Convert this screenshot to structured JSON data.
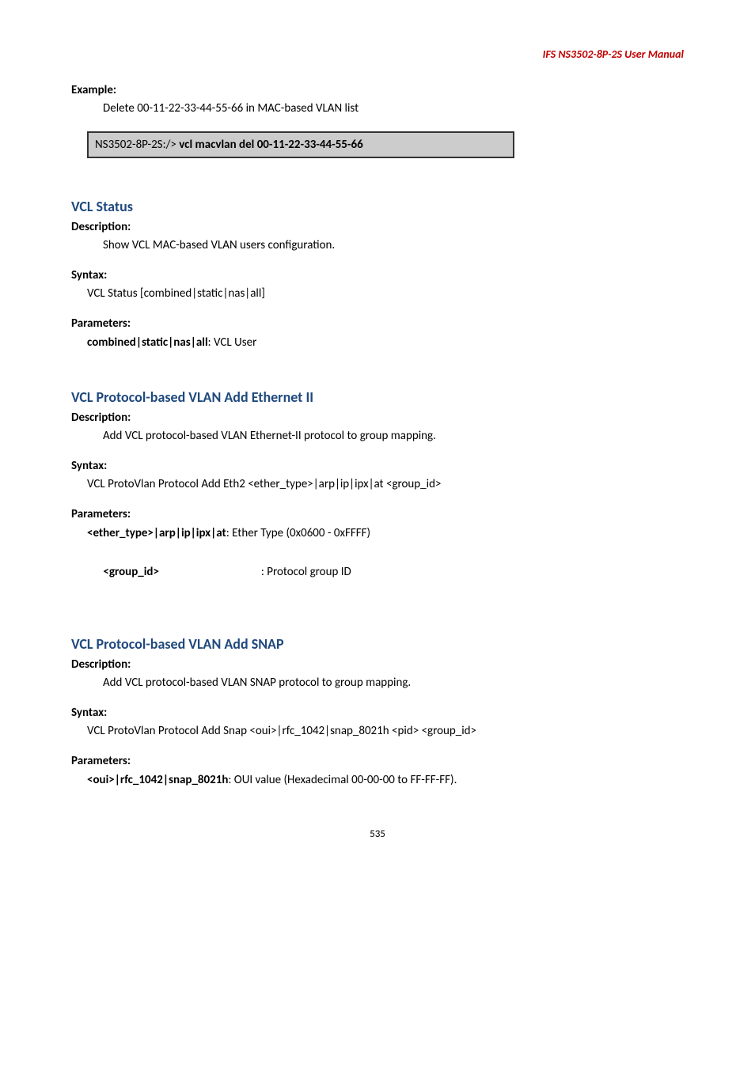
{
  "header": {
    "product": "IFS  NS3502-8P-2S  User  Manual"
  },
  "example": {
    "label": "Example:",
    "text": "Delete 00-11-22-33-44-55-66 in MAC-based VLAN list",
    "codePrefix": "NS3502-8P-2S:/> ",
    "codeCmd": "vcl macvlan del 00-11-22-33-44-55-66"
  },
  "sections": [
    {
      "title": "VCL Status",
      "description": {
        "label": "Description:",
        "text": "Show VCL MAC-based VLAN users configuration."
      },
      "syntax": {
        "label": "Syntax:",
        "text": "VCL Status [combined|static|nas|all]"
      },
      "parameters": {
        "label": "Parameters:",
        "items": [
          {
            "name": "combined|static|nas|all",
            "desc": ": VCL User"
          }
        ]
      }
    },
    {
      "title": "VCL Protocol-based VLAN Add Ethernet II",
      "description": {
        "label": "Description:",
        "text": "Add VCL protocol-based VLAN Ethernet-II protocol to group mapping."
      },
      "syntax": {
        "label": "Syntax:",
        "text": "VCL ProtoVlan Protocol Add Eth2 <ether_type>|arp|ip|ipx|at <group_id>"
      },
      "parameters": {
        "label": "Parameters:",
        "items": [
          {
            "name": "<ether_type>|arp|ip|ipx|at",
            "desc": ": Ether Type (0x0600 - 0xFFFF)"
          },
          {
            "name": "<group_id>",
            "desc": ": Protocol group ID",
            "pad": "                                      "
          }
        ]
      }
    },
    {
      "title": "VCL Protocol-based VLAN Add SNAP",
      "description": {
        "label": "Description:",
        "text": "Add VCL protocol-based VLAN SNAP protocol to group mapping."
      },
      "syntax": {
        "label": "Syntax:",
        "text": "VCL ProtoVlan Protocol Add Snap <oui>|rfc_1042|snap_8021h <pid> <group_id>"
      },
      "parameters": {
        "label": "Parameters:",
        "items": [
          {
            "name": "<oui>|rfc_1042|snap_8021h",
            "desc": ": OUI value (Hexadecimal 00-00-00 to FF-FF-FF)."
          }
        ]
      }
    }
  ],
  "pageNumber": "535"
}
